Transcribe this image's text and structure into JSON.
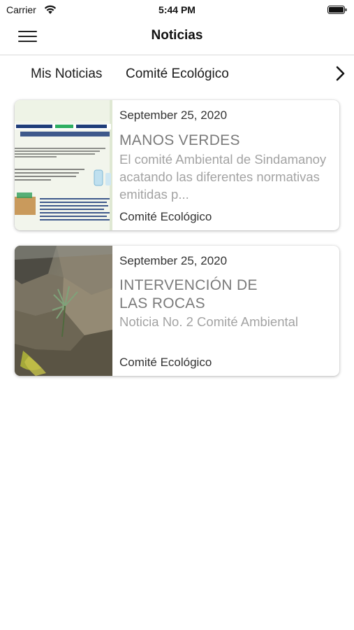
{
  "status_bar": {
    "carrier": "Carrier",
    "time": "5:44 PM"
  },
  "navbar": {
    "title": "Noticias"
  },
  "tabs": [
    {
      "label": "Mis Noticias"
    },
    {
      "label": "Comité Ecológico"
    }
  ],
  "news": [
    {
      "date": "September 25, 2020",
      "title": "MANOS VERDES",
      "excerpt": "El comité Ambiental de Sindamanoy acatando las diferentes normativas emitidas p...",
      "category": "Comité Ecológico",
      "thumbnail": "manos-verdes-poster"
    },
    {
      "date": "September 25, 2020",
      "title": "INTERVENCIÓN DE LAS ROCAS",
      "excerpt": "Noticia No. 2 Comité Ambiental",
      "category": "Comité Ecológico",
      "thumbnail": "rocks-photo"
    }
  ],
  "icons": {
    "menu": "hamburger-icon",
    "next": "chevron-right-icon",
    "wifi": "wifi-icon",
    "battery": "battery-icon"
  },
  "colors": {
    "title_gray": "#7a7a7a",
    "excerpt_gray": "#a3a3a3",
    "divider": "#d9d9d9"
  }
}
